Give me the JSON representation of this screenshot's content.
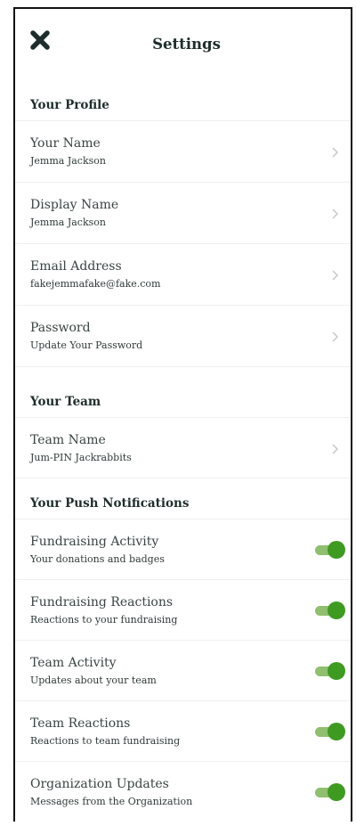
{
  "header": {
    "title": "Settings",
    "close_icon": "close-icon"
  },
  "profile": {
    "section_title": "Your Profile",
    "rows": [
      {
        "label": "Your Name",
        "value": "Jemma Jackson"
      },
      {
        "label": "Display Name",
        "value": "Jemma Jackson"
      },
      {
        "label": "Email Address",
        "value": "fakejemmafake@fake.com"
      },
      {
        "label": "Password",
        "value": "Update Your Password"
      }
    ]
  },
  "team": {
    "section_title": "Your Team",
    "rows": [
      {
        "label": "Team Name",
        "value": "Jum-PIN Jackrabbits"
      }
    ]
  },
  "notifications": {
    "section_title": "Your Push Notifications",
    "rows": [
      {
        "label": "Fundraising Activity",
        "sub": "Your donations and badges",
        "enabled": true
      },
      {
        "label": "Fundraising Reactions",
        "sub": "Reactions to your fundraising",
        "enabled": true
      },
      {
        "label": "Team Activity",
        "sub": "Updates about your team",
        "enabled": true
      },
      {
        "label": "Team Reactions",
        "sub": "Reactions to team fundraising",
        "enabled": true
      },
      {
        "label": "Organization Updates",
        "sub": "Messages from the Organization",
        "enabled": true
      }
    ]
  },
  "colors": {
    "toggle_on": "#3f9a22",
    "toggle_track": "#8fbf6f",
    "title": "#1e2d2b"
  }
}
